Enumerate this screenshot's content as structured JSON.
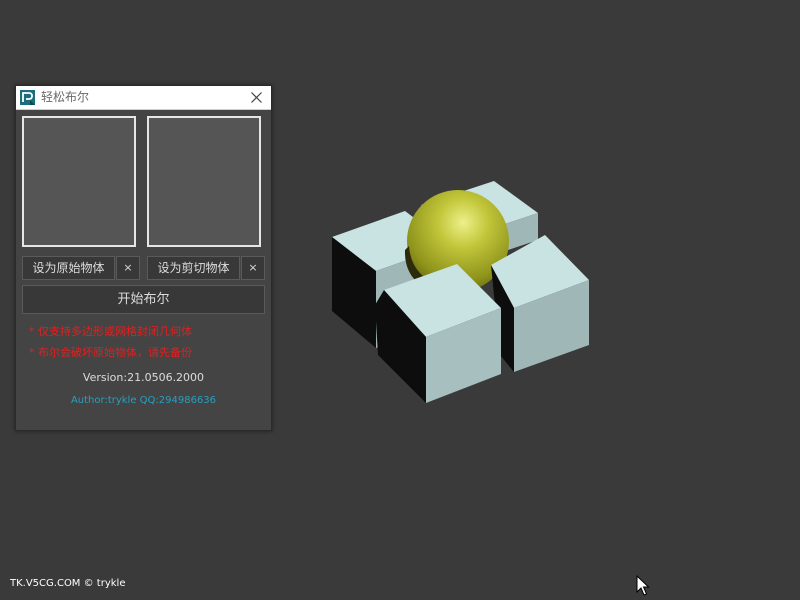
{
  "dialog": {
    "title": "轻松布尔",
    "set_original_label": "设为原始物体",
    "set_cutter_label": "设为剪切物体",
    "clear_label": "×",
    "start_label": "开始布尔",
    "notes": [
      "* 仅支持多边形或网格封闭几何体",
      "* 布尔会破坏原始物体，请先备份"
    ],
    "version": "Version:21.0506.2000",
    "author": "Author:trykle QQ:294986636"
  },
  "watermark": "TK.V5CG.COM © trykle",
  "icons": {
    "app": "3dsmax-app-icon",
    "close": "close-icon",
    "cursor": "mouse-pointer-icon"
  },
  "colors": {
    "background": "#3a3a3a",
    "panel": "#444444",
    "note": "#e02020",
    "author": "#2a9fbe",
    "cube_top": "#c9e2e2",
    "cube_side": "#9fb7b7",
    "sphere": "#b7bb2f"
  }
}
